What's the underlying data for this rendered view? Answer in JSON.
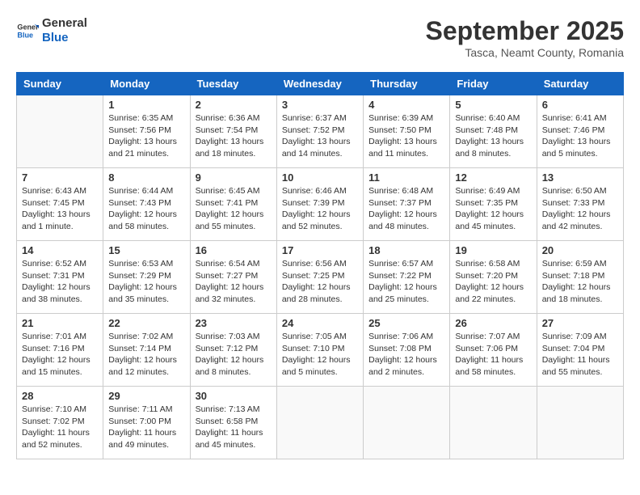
{
  "header": {
    "logo_line1": "General",
    "logo_line2": "Blue",
    "month": "September 2025",
    "location": "Tasca, Neamt County, Romania"
  },
  "weekdays": [
    "Sunday",
    "Monday",
    "Tuesday",
    "Wednesday",
    "Thursday",
    "Friday",
    "Saturday"
  ],
  "weeks": [
    [
      {
        "day": "",
        "info": ""
      },
      {
        "day": "1",
        "info": "Sunrise: 6:35 AM\nSunset: 7:56 PM\nDaylight: 13 hours\nand 21 minutes."
      },
      {
        "day": "2",
        "info": "Sunrise: 6:36 AM\nSunset: 7:54 PM\nDaylight: 13 hours\nand 18 minutes."
      },
      {
        "day": "3",
        "info": "Sunrise: 6:37 AM\nSunset: 7:52 PM\nDaylight: 13 hours\nand 14 minutes."
      },
      {
        "day": "4",
        "info": "Sunrise: 6:39 AM\nSunset: 7:50 PM\nDaylight: 13 hours\nand 11 minutes."
      },
      {
        "day": "5",
        "info": "Sunrise: 6:40 AM\nSunset: 7:48 PM\nDaylight: 13 hours\nand 8 minutes."
      },
      {
        "day": "6",
        "info": "Sunrise: 6:41 AM\nSunset: 7:46 PM\nDaylight: 13 hours\nand 5 minutes."
      }
    ],
    [
      {
        "day": "7",
        "info": "Sunrise: 6:43 AM\nSunset: 7:45 PM\nDaylight: 13 hours\nand 1 minute."
      },
      {
        "day": "8",
        "info": "Sunrise: 6:44 AM\nSunset: 7:43 PM\nDaylight: 12 hours\nand 58 minutes."
      },
      {
        "day": "9",
        "info": "Sunrise: 6:45 AM\nSunset: 7:41 PM\nDaylight: 12 hours\nand 55 minutes."
      },
      {
        "day": "10",
        "info": "Sunrise: 6:46 AM\nSunset: 7:39 PM\nDaylight: 12 hours\nand 52 minutes."
      },
      {
        "day": "11",
        "info": "Sunrise: 6:48 AM\nSunset: 7:37 PM\nDaylight: 12 hours\nand 48 minutes."
      },
      {
        "day": "12",
        "info": "Sunrise: 6:49 AM\nSunset: 7:35 PM\nDaylight: 12 hours\nand 45 minutes."
      },
      {
        "day": "13",
        "info": "Sunrise: 6:50 AM\nSunset: 7:33 PM\nDaylight: 12 hours\nand 42 minutes."
      }
    ],
    [
      {
        "day": "14",
        "info": "Sunrise: 6:52 AM\nSunset: 7:31 PM\nDaylight: 12 hours\nand 38 minutes."
      },
      {
        "day": "15",
        "info": "Sunrise: 6:53 AM\nSunset: 7:29 PM\nDaylight: 12 hours\nand 35 minutes."
      },
      {
        "day": "16",
        "info": "Sunrise: 6:54 AM\nSunset: 7:27 PM\nDaylight: 12 hours\nand 32 minutes."
      },
      {
        "day": "17",
        "info": "Sunrise: 6:56 AM\nSunset: 7:25 PM\nDaylight: 12 hours\nand 28 minutes."
      },
      {
        "day": "18",
        "info": "Sunrise: 6:57 AM\nSunset: 7:22 PM\nDaylight: 12 hours\nand 25 minutes."
      },
      {
        "day": "19",
        "info": "Sunrise: 6:58 AM\nSunset: 7:20 PM\nDaylight: 12 hours\nand 22 minutes."
      },
      {
        "day": "20",
        "info": "Sunrise: 6:59 AM\nSunset: 7:18 PM\nDaylight: 12 hours\nand 18 minutes."
      }
    ],
    [
      {
        "day": "21",
        "info": "Sunrise: 7:01 AM\nSunset: 7:16 PM\nDaylight: 12 hours\nand 15 minutes."
      },
      {
        "day": "22",
        "info": "Sunrise: 7:02 AM\nSunset: 7:14 PM\nDaylight: 12 hours\nand 12 minutes."
      },
      {
        "day": "23",
        "info": "Sunrise: 7:03 AM\nSunset: 7:12 PM\nDaylight: 12 hours\nand 8 minutes."
      },
      {
        "day": "24",
        "info": "Sunrise: 7:05 AM\nSunset: 7:10 PM\nDaylight: 12 hours\nand 5 minutes."
      },
      {
        "day": "25",
        "info": "Sunrise: 7:06 AM\nSunset: 7:08 PM\nDaylight: 12 hours\nand 2 minutes."
      },
      {
        "day": "26",
        "info": "Sunrise: 7:07 AM\nSunset: 7:06 PM\nDaylight: 11 hours\nand 58 minutes."
      },
      {
        "day": "27",
        "info": "Sunrise: 7:09 AM\nSunset: 7:04 PM\nDaylight: 11 hours\nand 55 minutes."
      }
    ],
    [
      {
        "day": "28",
        "info": "Sunrise: 7:10 AM\nSunset: 7:02 PM\nDaylight: 11 hours\nand 52 minutes."
      },
      {
        "day": "29",
        "info": "Sunrise: 7:11 AM\nSunset: 7:00 PM\nDaylight: 11 hours\nand 49 minutes."
      },
      {
        "day": "30",
        "info": "Sunrise: 7:13 AM\nSunset: 6:58 PM\nDaylight: 11 hours\nand 45 minutes."
      },
      {
        "day": "",
        "info": ""
      },
      {
        "day": "",
        "info": ""
      },
      {
        "day": "",
        "info": ""
      },
      {
        "day": "",
        "info": ""
      }
    ]
  ]
}
